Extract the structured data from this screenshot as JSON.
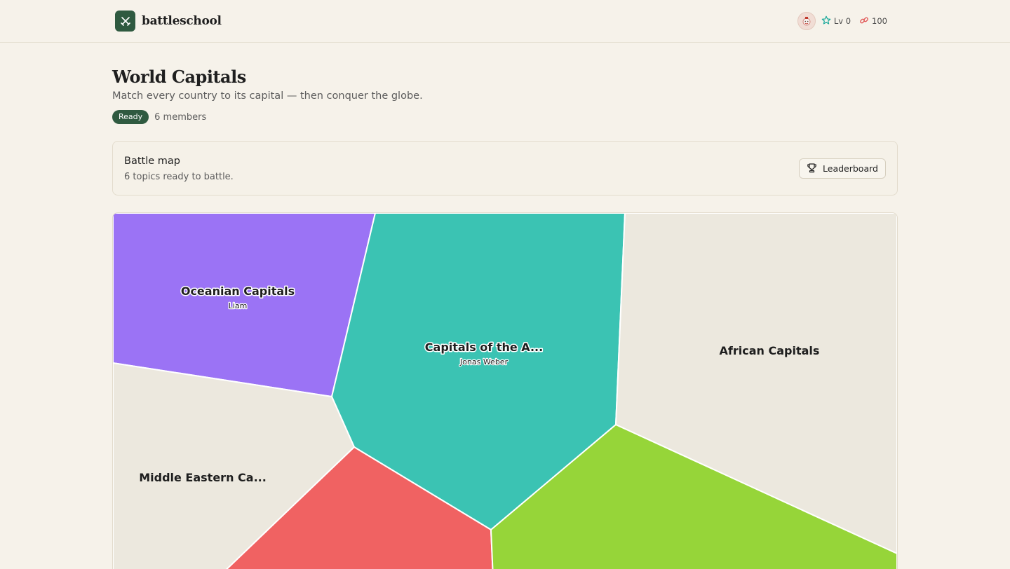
{
  "app": {
    "name": "battleschool",
    "logo_icon": "crossed-swords-icon"
  },
  "user": {
    "avatar_icon": "avatar-icon",
    "level_label": "Lv 0",
    "level_icon": "star-icon",
    "points": "100",
    "points_icon": "link-icon"
  },
  "page": {
    "title": "World Capitals",
    "subtitle": "Match every country to its capital — then conquer the globe.",
    "status": "Ready",
    "members": "6 members"
  },
  "battle_panel": {
    "title": "Battle map",
    "subtitle": "6 topics ready to battle.",
    "leaderboard_label": "Leaderboard",
    "leaderboard_icon": "trophy-icon"
  },
  "map": {
    "territories": [
      {
        "id": "oceanian",
        "label": "Oceanian Capitals",
        "owner": "Liam",
        "color": "#9b73f5"
      },
      {
        "id": "americas",
        "label": "Capitals of the A...",
        "owner": "Jonas Weber",
        "color": "#3bc3b3"
      },
      {
        "id": "african",
        "label": "African Capitals",
        "owner": "",
        "color": "#ece8de"
      },
      {
        "id": "middle-eastern",
        "label": "Middle Eastern Ca...",
        "owner": "",
        "color": "#ece8de"
      },
      {
        "id": "red-topic",
        "label": "",
        "owner": "",
        "color": "#f06262"
      },
      {
        "id": "green-topic",
        "label": "",
        "owner": "",
        "color": "#96d539"
      }
    ]
  }
}
